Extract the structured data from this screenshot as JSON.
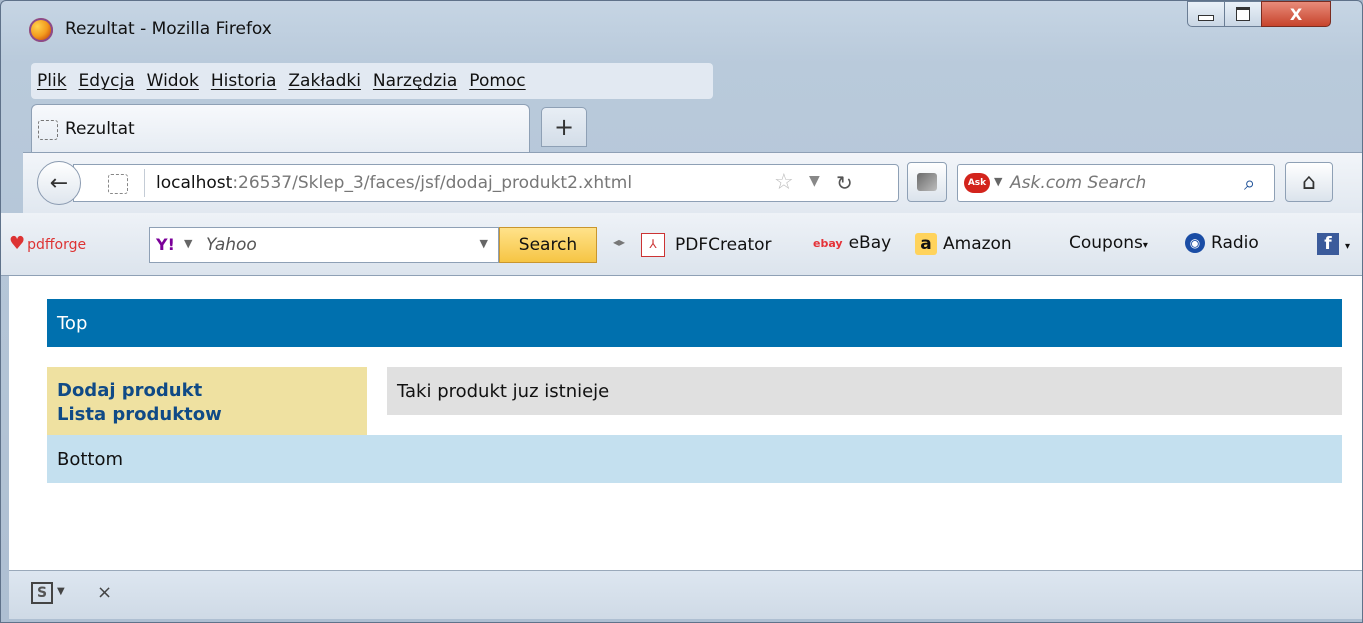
{
  "window": {
    "title": "Rezultat - Mozilla Firefox",
    "minimize": "–",
    "maximize": "□",
    "close": "X"
  },
  "menubar": {
    "items": [
      "Plik",
      "Edycja",
      "Widok",
      "Historia",
      "Zakładki",
      "Narzędzia",
      "Pomoc"
    ]
  },
  "tabs": {
    "active_label": "Rezultat",
    "new_tab": "+"
  },
  "navigation": {
    "url_host": "localhost",
    "url_rest": ":26537/Sklep_3/faces/jsf/dodaj_produkt2.xhtml",
    "search_placeholder": "Ask.com Search",
    "search_logo": "Ask"
  },
  "toolbar": {
    "pdfforge": "pdfforge",
    "yahoo_label": "Yahoo",
    "yahoo_logo": "Y!",
    "search_button": "Search",
    "items": [
      "PDFCreator",
      "eBay",
      "Amazon",
      "Coupons",
      "Radio"
    ],
    "ebay_logo": "ebay",
    "amazon_logo": "a",
    "facebook_logo": "f"
  },
  "page": {
    "top": "Top",
    "links": [
      "Dodaj produkt",
      "Lista produktow"
    ],
    "message": "Taki produkt juz istnieje",
    "bottom": "Bottom"
  },
  "statusbar": {
    "addon": "S",
    "close": "×"
  },
  "colors": {
    "top_bar": "#0070ae",
    "left_panel": "#efe1a1",
    "message_box": "#e0e0e0",
    "bottom_bar": "#c4e0ef"
  }
}
